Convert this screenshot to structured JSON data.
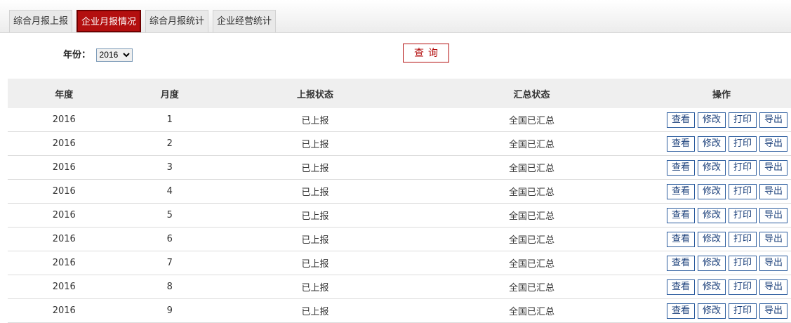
{
  "tabs": [
    {
      "label": "综合月报上报",
      "active": false
    },
    {
      "label": "企业月报情况",
      "active": true
    },
    {
      "label": "综合月报统计",
      "active": false
    },
    {
      "label": "企业经营统计",
      "active": false
    }
  ],
  "filter": {
    "year_label": "年份：",
    "year_value": "2016"
  },
  "query_button": "查询",
  "table": {
    "headers": [
      "年度",
      "月度",
      "上报状态",
      "汇总状态",
      "操作"
    ],
    "actions": [
      "查看",
      "修改",
      "打印",
      "导出"
    ],
    "rows": [
      {
        "year": "2016",
        "month": "1",
        "report_status": "已上报",
        "summary_status": "全国已汇总"
      },
      {
        "year": "2016",
        "month": "2",
        "report_status": "已上报",
        "summary_status": "全国已汇总"
      },
      {
        "year": "2016",
        "month": "3",
        "report_status": "已上报",
        "summary_status": "全国已汇总"
      },
      {
        "year": "2016",
        "month": "4",
        "report_status": "已上报",
        "summary_status": "全国已汇总"
      },
      {
        "year": "2016",
        "month": "5",
        "report_status": "已上报",
        "summary_status": "全国已汇总"
      },
      {
        "year": "2016",
        "month": "6",
        "report_status": "已上报",
        "summary_status": "全国已汇总"
      },
      {
        "year": "2016",
        "month": "7",
        "report_status": "已上报",
        "summary_status": "全国已汇总"
      },
      {
        "year": "2016",
        "month": "8",
        "report_status": "已上报",
        "summary_status": "全国已汇总"
      },
      {
        "year": "2016",
        "month": "9",
        "report_status": "已上报",
        "summary_status": "全国已汇总"
      }
    ]
  },
  "colors": {
    "accent": "#b30f0f",
    "action_border": "#2b5c9e"
  }
}
